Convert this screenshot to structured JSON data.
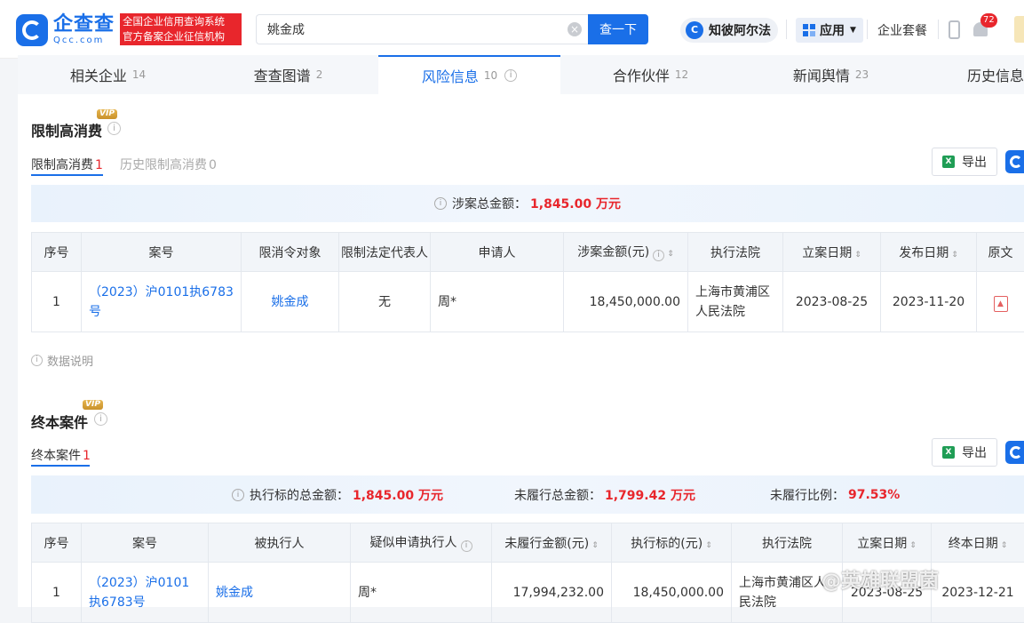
{
  "header": {
    "logo_name": "企查查",
    "logo_sub": "Qcc.com",
    "slogan_line1": "全国企业信用查询系统",
    "slogan_line2": "官方备案企业征信机构",
    "search_value": "姚金成",
    "search_button": "查一下",
    "zhibi_label": "知彼阿尔法",
    "app_label": "应用",
    "package_label": "企业套餐",
    "notification_count": "72"
  },
  "tabs": [
    {
      "label": "相关企业",
      "count": "14"
    },
    {
      "label": "查查图谱",
      "count": "2"
    },
    {
      "label": "风险信息",
      "count": "10"
    },
    {
      "label": "合作伙伴",
      "count": "12"
    },
    {
      "label": "新闻舆情",
      "count": "23"
    },
    {
      "label": "历史信息",
      "count": ""
    }
  ],
  "section1": {
    "title": "限制高消费",
    "vip": "VIP",
    "subtab_active": "限制高消费",
    "subtab_active_count": "1",
    "subtab_inactive": "历史限制高消费",
    "subtab_inactive_count": "0",
    "export_label": "导出",
    "summary_label": "涉案总金额：",
    "summary_value": "1,845.00 万元",
    "columns": [
      "序号",
      "案号",
      "限消令对象",
      "限制法定代表人",
      "申请人",
      "涉案金额(元)",
      "执行法院",
      "立案日期",
      "发布日期",
      "原文"
    ],
    "rows": [
      {
        "idx": "1",
        "case_no": "（2023）沪0101执6783号",
        "target": "姚金成",
        "legal_rep": "无",
        "applicant": "周*",
        "amount": "18,450,000.00",
        "court": "上海市黄浦区人民法院",
        "filed": "2023-08-25",
        "published": "2023-11-20"
      }
    ],
    "note": "数据说明"
  },
  "section2": {
    "title": "终本案件",
    "vip": "VIP",
    "subtab_active": "终本案件",
    "subtab_active_count": "1",
    "export_label": "导出",
    "summary": [
      {
        "label": "执行标的总金额：",
        "value": "1,845.00 万元"
      },
      {
        "label": "未履行总金额：",
        "value": "1,799.42 万元"
      },
      {
        "label": "未履行比例：",
        "value": "97.53%"
      }
    ],
    "columns": [
      "序号",
      "案号",
      "被执行人",
      "疑似申请执行人",
      "未履行金额(元)",
      "执行标的(元)",
      "执行法院",
      "立案日期",
      "终本日期"
    ],
    "rows": [
      {
        "idx": "1",
        "case_no": "（2023）沪0101执6783号",
        "executee": "姚金成",
        "applicant": "周*",
        "unpaid": "17,994,232.00",
        "target_amount": "18,450,000.00",
        "court": "上海市黄浦区人民法院",
        "filed": "2023-08-25",
        "ended": "2023-12-21"
      }
    ]
  },
  "watermark": "@英雄联盟菌"
}
